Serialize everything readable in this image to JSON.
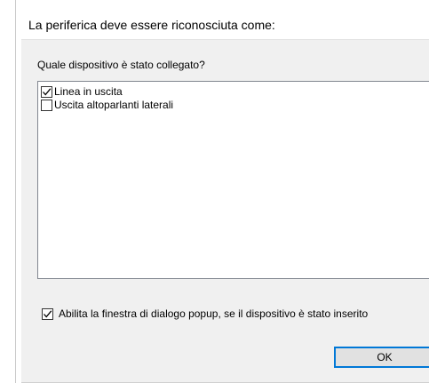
{
  "dialog": {
    "title": "La periferica deve essere riconosciuta come:",
    "question": "Quale dispositivo è stato collegato?",
    "devices": [
      {
        "label": "Linea in uscita",
        "checked": true
      },
      {
        "label": "Uscita altoparlanti laterali",
        "checked": false
      }
    ],
    "popup_option": {
      "label": "Abilita la finestra di dialogo popup, se il dispositivo è stato inserito",
      "checked": true
    },
    "ok_label": "OK"
  },
  "colors": {
    "body_background": "#f0f0f0",
    "button_border": "#0078d7",
    "button_background": "#e1e1e1"
  },
  "icons": {
    "checkmark": "checkmark-icon"
  }
}
